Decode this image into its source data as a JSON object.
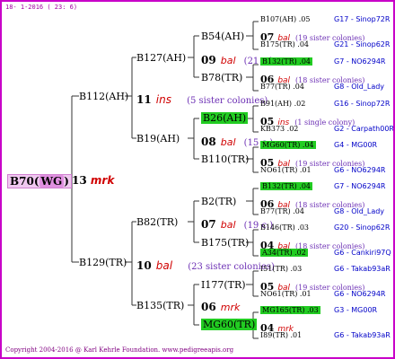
{
  "header": "18- 1-2016 ( 23: 6)",
  "footer": "Copyright 2004-2016 @ Karl Kehrle Foundation.   www.pedigreeapis.org",
  "root": {
    "id": "B70",
    "tag": "WG"
  },
  "gen1": {
    "num": "13",
    "tag": "mrk"
  },
  "left": {
    "parent": "B112(AH)",
    "num": "11",
    "tag": "ins",
    "sisters": "(5 sister colonies)",
    "a": {
      "parent": "B127(AH)",
      "num": "09",
      "tag": "bal",
      "sisters": "(21 c.)",
      "top": "B54(AH)",
      "bottom": "B78(TR)"
    },
    "b": {
      "parent": "B19(AH)",
      "num": "08",
      "tag": "bal",
      "sisters": "(15 c.)",
      "top": "B26(AH)",
      "bottom": "B110(TR)"
    }
  },
  "right": {
    "parent": "B129(TR)",
    "num": "10",
    "tag": "bal",
    "sisters": "(23 sister colonies)",
    "a": {
      "parent": "B82(TR)",
      "num": "07",
      "tag": "bal",
      "sisters": "(19 c.)",
      "top": "B2(TR)",
      "bottom": "B175(TR)"
    },
    "b": {
      "parent": "B135(TR)",
      "num": "06",
      "tag": "mrk",
      "top": "I177(TR)",
      "bottom": "MG60(TR)"
    }
  },
  "leaves": [
    {
      "a": "B107(AH) .05",
      "b": "G17 - Sinop72R",
      "n": "07",
      "t": "bal",
      "s": "(19 sister colonies)",
      "c": "B175(TR) .04",
      "d": "G21 - Sinop62R"
    },
    {
      "a": "B132(TR) .04",
      "b": "G7 - NO6294R",
      "n": "06",
      "t": "bal",
      "s": "(18 sister colonies)",
      "c": "B77(TR) .04",
      "d": "G8 - Old_Lady"
    },
    {
      "a": "B91(AH) .02",
      "b": "G16 - Sinop72R",
      "n": "05",
      "t": "ins",
      "s": "(1 single colony)",
      "c": "KB373 .02",
      "d": "G2 - Carpath00R"
    },
    {
      "a": "MG60(TR) .04",
      "b": "G4 - MG00R",
      "n": "05",
      "t": "bal",
      "s": "(19 sister colonies)",
      "c": "NO61(TR) .01",
      "d": "G6 - NO6294R"
    },
    {
      "a": "B132(TR) .04",
      "b": "G7 - NO6294R",
      "n": "06",
      "t": "bal",
      "s": "(18 sister colonies)",
      "c": "B77(TR) .04",
      "d": "G8 - Old_Lady"
    },
    {
      "a": "B146(TR) .03",
      "b": "G20 - Sinop62R",
      "n": "04",
      "t": "bal",
      "s": "(18 sister colonies)",
      "c": "A34(TR) .02",
      "d": "G6 - Cankiri97Q"
    },
    {
      "a": "I51(TR) .03",
      "b": "G6 - Takab93aR",
      "n": "05",
      "t": "bal",
      "s": "(19 sister colonies)",
      "c": "NO61(TR) .01",
      "d": "G6 - NO6294R"
    },
    {
      "a": "MG165(TR) .03",
      "b": "G3 - MG00R",
      "n": "04",
      "t": "mrk",
      "s": "",
      "c": "I89(TR) .01",
      "d": "G6 - Takab93aR"
    }
  ]
}
